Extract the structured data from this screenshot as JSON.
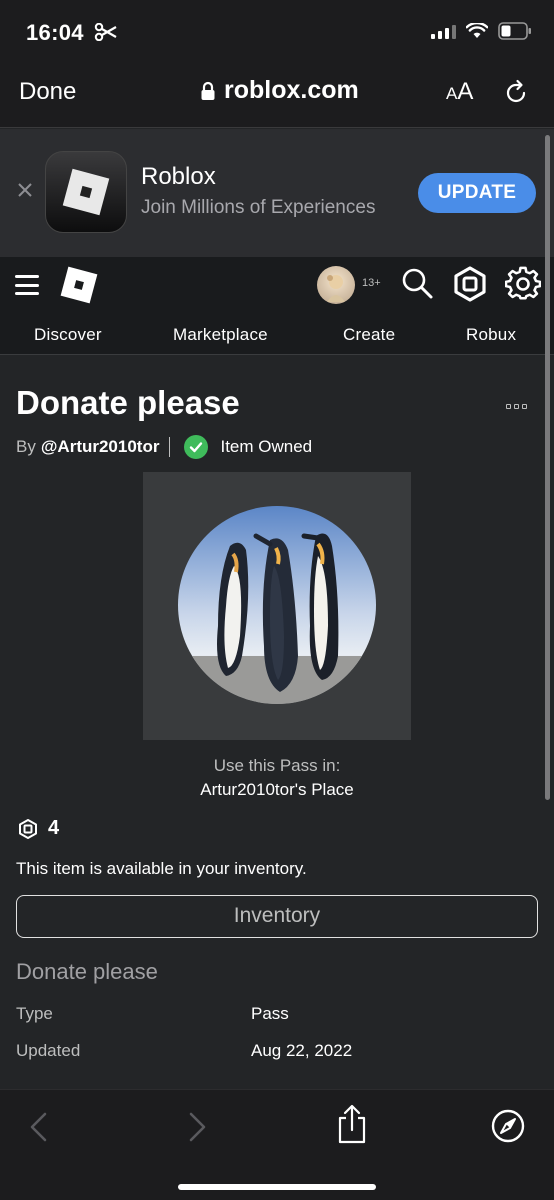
{
  "status_bar": {
    "time": "16:04"
  },
  "browser": {
    "done_label": "Done",
    "url": "roblox.com",
    "text_size_label_small": "A",
    "text_size_label_large": "A"
  },
  "app_banner": {
    "app_name": "Roblox",
    "subtitle": "Join Millions of Experiences",
    "update_label": "UPDATE"
  },
  "header": {
    "age_label": "13+",
    "nav": [
      "Discover",
      "Marketplace",
      "Create",
      "Robux"
    ]
  },
  "item": {
    "title": "Donate please",
    "by_prefix": "By",
    "creator": "@Artur2010tor",
    "owned_label": "Item Owned",
    "use_in_label": "Use this Pass in:",
    "place_name": "Artur2010tor's Place",
    "price": "4",
    "availability": "This item is available in your inventory.",
    "inventory_button": "Inventory"
  },
  "details": {
    "section_title": "Donate please",
    "rows": [
      {
        "label": "Type",
        "value": "Pass"
      },
      {
        "label": "Updated",
        "value": "Aug 22, 2022"
      }
    ]
  },
  "colors": {
    "accent_blue": "#4a8de8",
    "owned_green": "#3fbb5b",
    "page_bg": "#232527"
  }
}
